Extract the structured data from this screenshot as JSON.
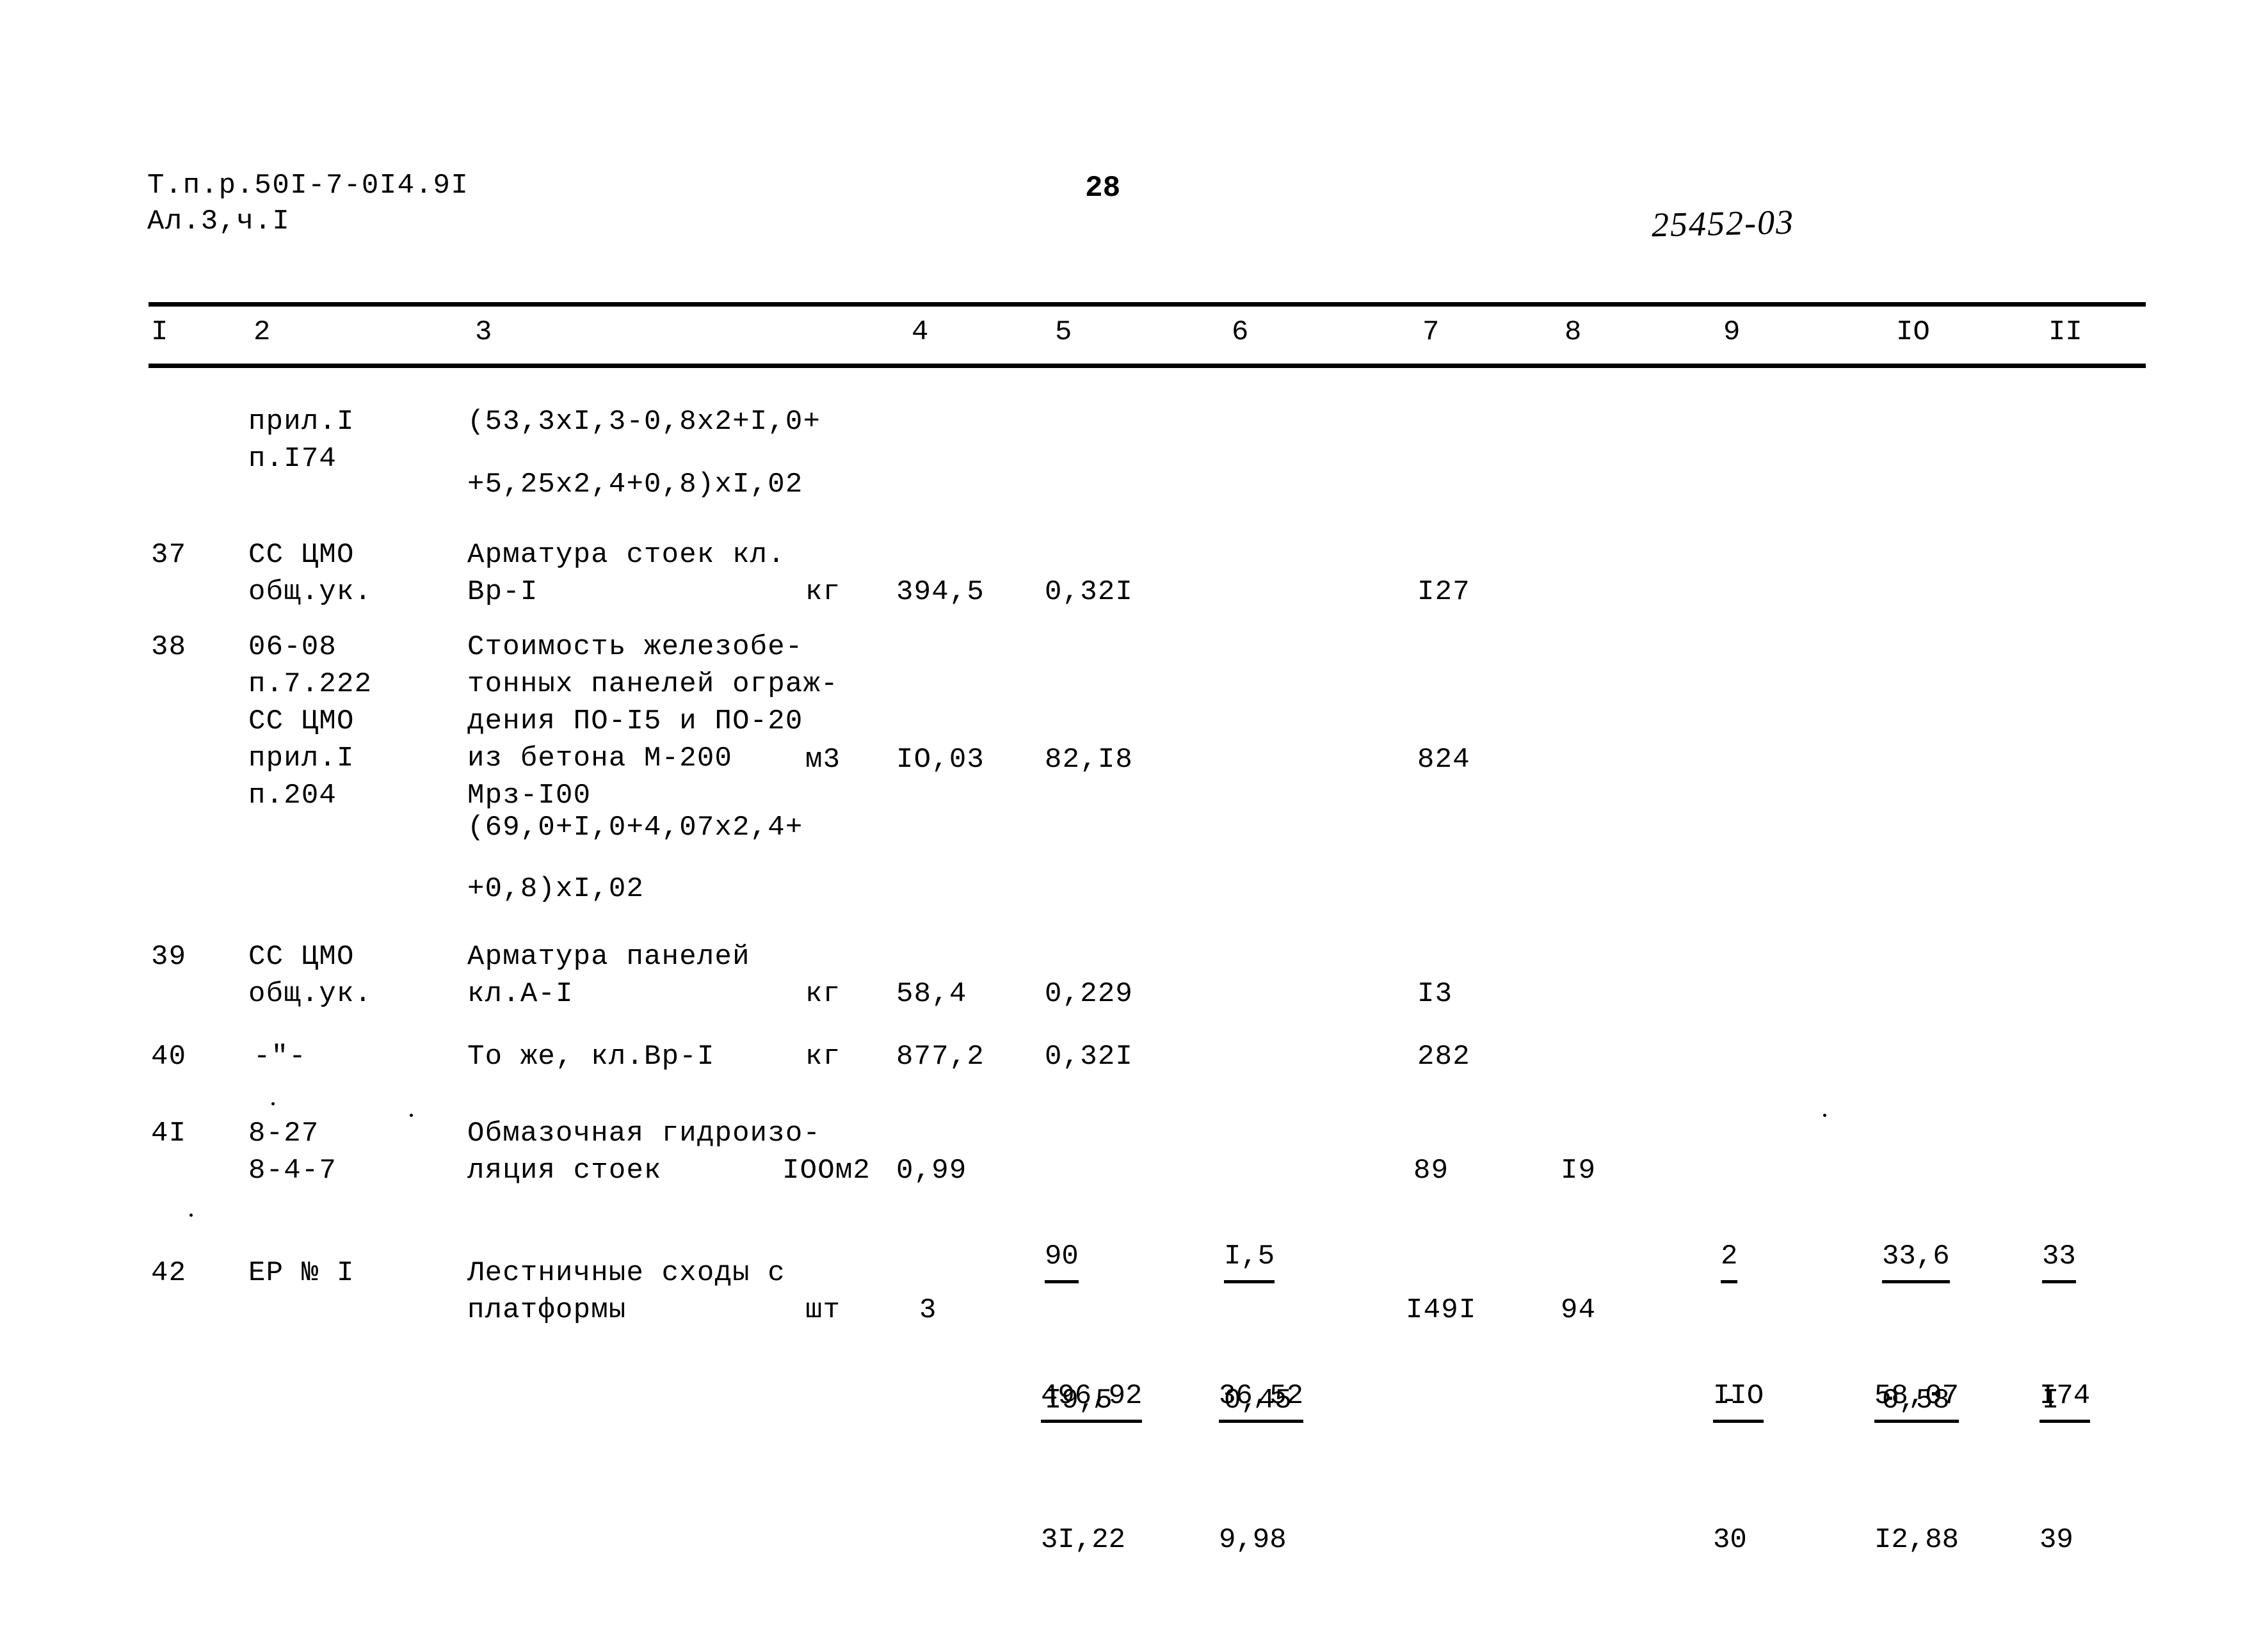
{
  "header": {
    "doc_code_line1": "Т.п.р.50I-7-0I4.9I",
    "doc_code_line2": "Ал.3,ч.I",
    "page_number": "28",
    "archive_code": "25452-03"
  },
  "table": {
    "column_headers": [
      "I",
      "2",
      "3",
      "4",
      "5",
      "6",
      "7",
      "8",
      "9",
      "IO",
      "II"
    ],
    "rows": [
      {
        "no": "",
        "code": "прил.I\nп.I74",
        "description": "(53,3xI,3-0,8x2+I,0+",
        "description2": "+5,25x2,4+0,8)xI,02",
        "unit": "",
        "c4": "",
        "c5": "",
        "c6": "",
        "c7": "",
        "c8": "",
        "c9": "",
        "c10": "",
        "c11": ""
      },
      {
        "no": "37",
        "code": "СС ЦМО\nобщ.ук.",
        "description": "Арматура стоек кл.\nВр-I",
        "unit": "кг",
        "c4": "394,5",
        "c5": "0,32I",
        "c6": "",
        "c7": "I27",
        "c8": "",
        "c9": "",
        "c10": "",
        "c11": ""
      },
      {
        "no": "38",
        "code": "06-08\nп.7.222\nСС ЦМО\nприл.I\nп.204",
        "description": "Стоимость железобе-\nтонных панелей ограж-\nдения ПО-I5 и ПО-20\nиз бетона М-200\nМрз-I00",
        "description2": "(69,0+I,0+4,07x2,4+",
        "description3": "+0,8)xI,02",
        "unit": "м3",
        "c4": "IO,03",
        "c5": "82,I8",
        "c6": "",
        "c7": "824",
        "c8": "",
        "c9": "",
        "c10": "",
        "c11": ""
      },
      {
        "no": "39",
        "code": "СС ЦМО\nобщ.ук.",
        "description": "Арматура панелей\nкл.А-I",
        "unit": "кг",
        "c4": "58,4",
        "c5": "0,229",
        "c6": "",
        "c7": "I3",
        "c8": "",
        "c9": "",
        "c10": "",
        "c11": ""
      },
      {
        "no": "40",
        "code": "-\"-",
        "description": "То же, кл.Вр-I",
        "unit": "кг",
        "c4": "877,2",
        "c5": "0,32I",
        "c6": "",
        "c7": "282",
        "c8": "",
        "c9": "",
        "c10": "",
        "c11": ""
      },
      {
        "no": "4I",
        "code": "8-27\n8-4-7",
        "description": "Обмазочная гидроизо-\nляция стоек",
        "unit": "IOOм2",
        "c4": "0,99",
        "c5_num": "90",
        "c5_den": "I9,5",
        "c6_num": "I,5",
        "c6_den": "0,45",
        "c7": "89",
        "c8": "I9",
        "c9_num": "2",
        "c9_den": "-",
        "c10_num": "33,6",
        "c10_den": "0,58",
        "c11_num": "33",
        "c11_den": "I"
      },
      {
        "no": "42",
        "code": "ЕР № I",
        "description": "Лестничные сходы с\nплатформы",
        "unit": "шт",
        "c4": "3",
        "c5_num": "496,92",
        "c5_den": "3I,22",
        "c6_num": "36,52",
        "c6_den": "9,98",
        "c7": "I49I",
        "c8": "94",
        "c9_num": "IIO",
        "c9_den": "30",
        "c10_num": "58,07",
        "c10_den": "I2,88",
        "c11_num": "I74",
        "c11_den": "39"
      }
    ]
  }
}
